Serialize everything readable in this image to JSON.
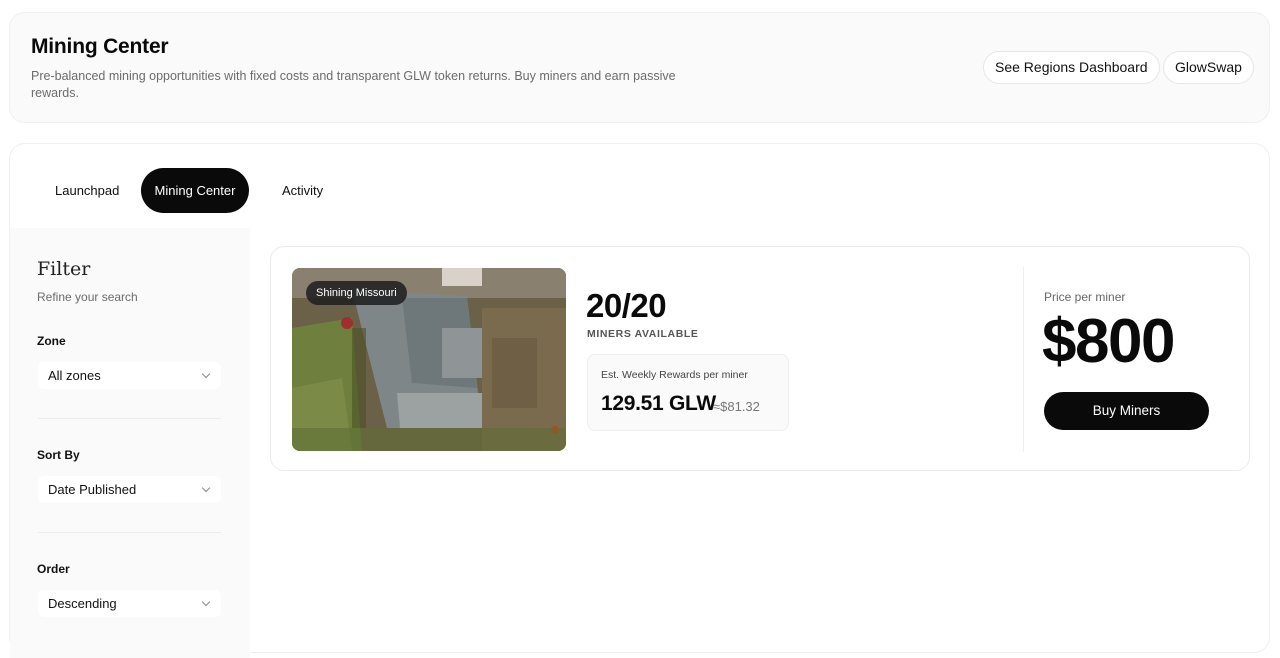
{
  "header": {
    "title": "Mining Center",
    "description": "Pre-balanced mining opportunities with fixed costs and transparent GLW token returns. Buy miners and earn passive rewards.",
    "buttons": {
      "regions": "See Regions Dashboard",
      "glowswap": "GlowSwap"
    }
  },
  "tabs": [
    {
      "label": "Launchpad",
      "active": false
    },
    {
      "label": "Mining Center",
      "active": true
    },
    {
      "label": "Activity",
      "active": false
    }
  ],
  "filter": {
    "title": "Filter",
    "subtitle": "Refine your search",
    "zone": {
      "label": "Zone",
      "value": "All zones"
    },
    "sort": {
      "label": "Sort By",
      "value": "Date Published"
    },
    "order": {
      "label": "Order",
      "value": "Descending"
    }
  },
  "listing": {
    "region": "Shining Missouri",
    "miners_count": "20/20",
    "miners_label": "MINERS AVAILABLE",
    "reward_title": "Est. Weekly Rewards per miner",
    "reward_glw": "129.51 GLW",
    "reward_usd": "≈$81.32",
    "price_label": "Price per miner",
    "price": "$800",
    "buy_label": "Buy Miners"
  },
  "colors": {
    "primary": "#0a0a0a",
    "surface": "#fafafa",
    "muted_text": "#6b6b6b"
  }
}
